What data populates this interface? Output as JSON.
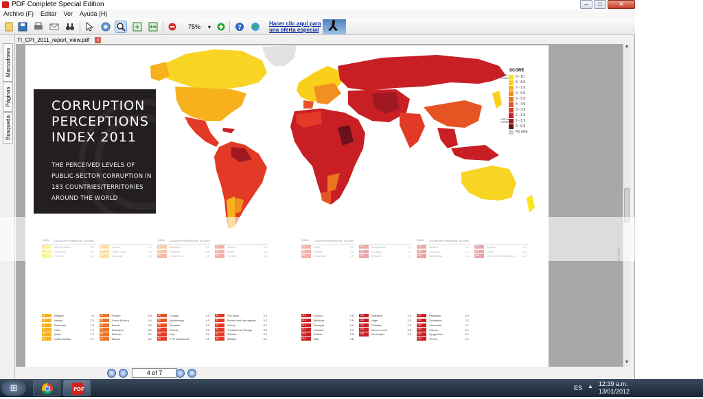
{
  "window": {
    "title": "PDF Complete Special Edition",
    "minimize": "–",
    "maximize": "□",
    "close": "✕"
  },
  "menu": [
    "Archivo (F)",
    "Editar",
    "Ver",
    "Ayuda (H)"
  ],
  "toolbar": {
    "zoom_value": "75%",
    "promo_text": "Hacer clic aquí para una oferta especial",
    "icons": [
      "new-icon",
      "save-icon",
      "print-icon",
      "email-icon",
      "binoculars-icon",
      "select-arrow-icon",
      "hand-icon",
      "zoom-icon",
      "fit-page-icon",
      "fit-width-icon",
      "stop-icon",
      "zoom-dropdown-icon",
      "zoom-in-icon",
      "help-icon",
      "globe-icon"
    ]
  },
  "side_tabs": [
    "Marcadores",
    "Páginas",
    "Búsqueda"
  ],
  "document": {
    "tab_label": "TI_CPI_2011_report_view.pdf",
    "close_label": "x"
  },
  "page": {
    "title": "CORRUPTION PERCEPTIONS INDEX 2011",
    "subtitle": "THE PERCEIVED LEVELS OF PUBLIC-SECTOR CORRUPTION IN 183 COUNTRIES/TERRITORIES AROUND THE WORLD",
    "legend": {
      "title": "SCORE",
      "very_clean": "VERY CLEAN",
      "highly_corrupt": "HIGHLY CORRUPT",
      "ranges": [
        {
          "label": "9 - 10",
          "color": "#f7e61d"
        },
        {
          "label": "8 - 8.9",
          "color": "#f9cf1a"
        },
        {
          "label": "7 - 7.9",
          "color": "#f6b11c"
        },
        {
          "label": "6 - 6.9",
          "color": "#f19020"
        },
        {
          "label": "5 - 5.9",
          "color": "#ec7322"
        },
        {
          "label": "4 - 4.9",
          "color": "#e65424"
        },
        {
          "label": "3 - 3.9",
          "color": "#e23a26"
        },
        {
          "label": "2 - 2.9",
          "color": "#c81f25"
        },
        {
          "label": "1 - 1.9",
          "color": "#a01922"
        },
        {
          "label": "0 - 0.9",
          "color": "#6a1119"
        },
        {
          "label": "No data",
          "color": "#cccccc"
        }
      ]
    },
    "table_headers": {
      "rank": "RANK",
      "country": "COUNTRY/TERRITORY",
      "score": "SCORE"
    },
    "tables": [
      [
        {
          "rank": "1",
          "name": "New Zealand",
          "score": "9.5",
          "color": "#f7e61d"
        },
        {
          "rank": "2",
          "name": "Denmark",
          "score": "9.4",
          "color": "#f7e61d"
        },
        {
          "rank": "2",
          "name": "Finland",
          "score": "9.4",
          "color": "#f7e61d"
        },
        {
          "rank": "19",
          "name": "Belgium",
          "score": "7.5",
          "color": "#f6b11c"
        },
        {
          "rank": "19",
          "name": "Ireland",
          "score": "7.5",
          "color": "#f6b11c"
        },
        {
          "rank": "21",
          "name": "Bahamas",
          "score": "7.3",
          "color": "#f6b11c"
        },
        {
          "rank": "22",
          "name": "Chile",
          "score": "7.2",
          "color": "#f6b11c"
        },
        {
          "rank": "22",
          "name": "Qatar",
          "score": "7.2",
          "color": "#f6b11c"
        },
        {
          "rank": "24",
          "name": "United States",
          "score": "7.1",
          "color": "#f6b11c"
        }
      ],
      [
        {
          "rank": "25",
          "name": "France",
          "score": "7.0",
          "color": "#f6b11c"
        },
        {
          "rank": "25",
          "name": "Saint Lucia",
          "score": "7.0",
          "color": "#f6b11c"
        },
        {
          "rank": "25",
          "name": "Uruguay",
          "score": "7.0",
          "color": "#f6b11c"
        },
        {
          "rank": "41",
          "name": "Poland",
          "score": "5.5",
          "color": "#ec7322"
        },
        {
          "rank": "43",
          "name": "Korea (South)",
          "score": "5.4",
          "color": "#ec7322"
        },
        {
          "rank": "44",
          "name": "Brunei",
          "score": "5.2",
          "color": "#ec7322"
        },
        {
          "rank": "44",
          "name": "Dominica",
          "score": "5.2",
          "color": "#ec7322"
        },
        {
          "rank": "46",
          "name": "Bahrain",
          "score": "5.1",
          "color": "#ec7322"
        },
        {
          "rank": "46",
          "name": "Macau",
          "score": "5.1",
          "color": "#ec7322"
        }
      ],
      [
        {
          "rank": "46",
          "name": "Mauritius",
          "score": "5.1",
          "color": "#ec7322"
        },
        {
          "rank": "49",
          "name": "Rwanda",
          "score": "5.0",
          "color": "#ec7322"
        },
        {
          "rank": "50",
          "name": "Costa Rica",
          "score": "4.8",
          "color": "#e65424"
        },
        {
          "rank": "66",
          "name": "Croatia",
          "score": "4.0",
          "color": "#e65424"
        },
        {
          "rank": "66",
          "name": "Montenegro",
          "score": "4.0",
          "color": "#e65424"
        },
        {
          "rank": "66",
          "name": "Slovakia",
          "score": "4.0",
          "color": "#e65424"
        },
        {
          "rank": "69",
          "name": "Ghana",
          "score": "3.9",
          "color": "#e23a26"
        },
        {
          "rank": "69",
          "name": "Italy",
          "score": "3.9",
          "color": "#e23a26"
        },
        {
          "rank": "69",
          "name": "FYR Macedonia",
          "score": "3.9",
          "color": "#e23a26"
        }
      ],
      [
        {
          "rank": "69",
          "name": "Samoa",
          "score": "3.9",
          "color": "#e23a26"
        },
        {
          "rank": "73",
          "name": "Brazil",
          "score": "3.8",
          "color": "#e23a26"
        },
        {
          "rank": "73",
          "name": "Tunisia",
          "score": "3.8",
          "color": "#e23a26"
        },
        {
          "rank": "86",
          "name": "Sri Lanka",
          "score": "3.3",
          "color": "#e23a26"
        },
        {
          "rank": "91",
          "name": "Bosnia and Herzegovina",
          "score": "3.2",
          "color": "#e23a26"
        },
        {
          "rank": "91",
          "name": "Liberia",
          "score": "3.2",
          "color": "#e23a26"
        },
        {
          "rank": "91",
          "name": "Trinidad and Tobago",
          "score": "3.2",
          "color": "#e23a26"
        },
        {
          "rank": "91",
          "name": "Zambia",
          "score": "3.2",
          "color": "#e23a26"
        },
        {
          "rank": "95",
          "name": "Albania",
          "score": "3.1",
          "color": "#e23a26"
        }
      ],
      [
        {
          "rank": "95",
          "name": "India",
          "score": "3.1",
          "color": "#e23a26"
        },
        {
          "rank": "95",
          "name": "Kiribati",
          "score": "3.1",
          "color": "#e23a26"
        },
        {
          "rank": "95",
          "name": "Swaziland",
          "score": "3.1",
          "color": "#e23a26"
        },
        {
          "rank": "112",
          "name": "Kosovo",
          "score": "2.9",
          "color": "#c81f25"
        },
        {
          "rank": "112",
          "name": "Moldova",
          "score": "2.9",
          "color": "#c81f25"
        },
        {
          "rank": "112",
          "name": "Senegal",
          "score": "2.9",
          "color": "#c81f25"
        },
        {
          "rank": "112",
          "name": "Vietnam",
          "score": "2.9",
          "color": "#c81f25"
        },
        {
          "rank": "118",
          "name": "Bolivia",
          "score": "2.8",
          "color": "#c81f25"
        },
        {
          "rank": "118",
          "name": "Mali",
          "score": "2.8",
          "color": "#c81f25"
        }
      ],
      [
        {
          "rank": "120",
          "name": "Bangladesh",
          "score": "2.7",
          "color": "#c81f25"
        },
        {
          "rank": "120",
          "name": "Ecuador",
          "score": "2.7",
          "color": "#c81f25"
        },
        {
          "rank": "120",
          "name": "Ethiopia",
          "score": "2.7",
          "color": "#c81f25"
        },
        {
          "rank": "134",
          "name": "Maldives",
          "score": "2.5",
          "color": "#c81f25"
        },
        {
          "rank": "134",
          "name": "Niger",
          "score": "2.5",
          "color": "#c81f25"
        },
        {
          "rank": "134",
          "name": "Pakistan",
          "score": "2.5",
          "color": "#c81f25"
        },
        {
          "rank": "134",
          "name": "Sierra Leone",
          "score": "2.5",
          "color": "#c81f25"
        },
        {
          "rank": "143",
          "name": "Azerbaijan",
          "score": "2.4",
          "color": "#c81f25"
        }
      ],
      [
        {
          "rank": "143",
          "name": "Belarus",
          "score": "2.4",
          "color": "#c81f25"
        },
        {
          "rank": "143",
          "name": "Comoros",
          "score": "2.4",
          "color": "#c81f25"
        },
        {
          "rank": "143",
          "name": "Mauritania",
          "score": "2.4",
          "color": "#c81f25"
        },
        {
          "rank": "154",
          "name": "Paraguay",
          "score": "2.2",
          "color": "#c81f25"
        },
        {
          "rank": "154",
          "name": "Zimbabwe",
          "score": "2.2",
          "color": "#c81f25"
        },
        {
          "rank": "164",
          "name": "Cambodia",
          "score": "2.1",
          "color": "#c81f25"
        },
        {
          "rank": "164",
          "name": "Guinea",
          "score": "2.1",
          "color": "#c81f25"
        },
        {
          "rank": "164",
          "name": "Kyrgyzstan",
          "score": "2.1",
          "color": "#c81f25"
        },
        {
          "rank": "164",
          "name": "Yemen",
          "score": "2.1",
          "color": "#c81f25"
        }
      ],
      [
        {
          "rank": "168",
          "name": "Angola",
          "score": "2.0",
          "color": "#c81f25"
        },
        {
          "rank": "168",
          "name": "Chad",
          "score": "2.0",
          "color": "#c81f25"
        },
        {
          "rank": "168",
          "name": "Democratic Republic of the Congo",
          "score": "2.0",
          "color": "#c81f25"
        }
      ]
    ]
  },
  "navigation": {
    "first": "«",
    "prev": "‹",
    "page_indicator": "4 of 7",
    "next": "›",
    "last": "»"
  },
  "taskbar": {
    "language": "ES",
    "time": "12:39 a.m.",
    "date": "13/01/2012"
  },
  "colors": {
    "accent": "#3c64a6",
    "map_red": "#e23a26",
    "map_dark": "#6a1119",
    "map_yellow": "#f7e61d",
    "ocean": "#ffffff"
  }
}
